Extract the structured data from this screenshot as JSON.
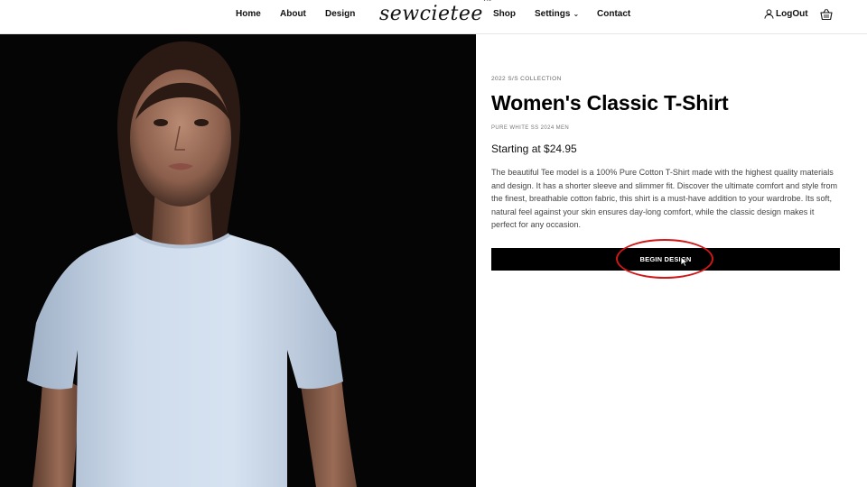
{
  "header": {
    "nav_left": [
      "Home",
      "About",
      "Design"
    ],
    "logo": "sewcietee",
    "logo_tm": "TM",
    "nav_right": [
      "Shop",
      "Settings",
      "Contact"
    ],
    "logout_label": "LogOut"
  },
  "hero": {
    "image": "woman-in-white-tshirt-on-black-background"
  },
  "product": {
    "collection": "2022 S/S COLLECTION",
    "title": "Women's Classic T-Shirt",
    "sku": "PURE WHITE SS 2024 MEN",
    "price": "Starting at $24.95",
    "description": "The beautiful Tee model is a 100% Pure Cotton T-Shirt made with the highest quality materials and design. It has a shorter sleeve and slimmer fit. Discover the ultimate comfort and style from the finest, breathable cotton fabric, this shirt is a must-have addition to your wardrobe. Its soft, natural feel against your skin ensures day-long comfort, while the classic design makes it perfect for any occasion.",
    "button_label": "BEGIN DESIGN"
  },
  "annotation": {
    "color": "#d01818"
  }
}
